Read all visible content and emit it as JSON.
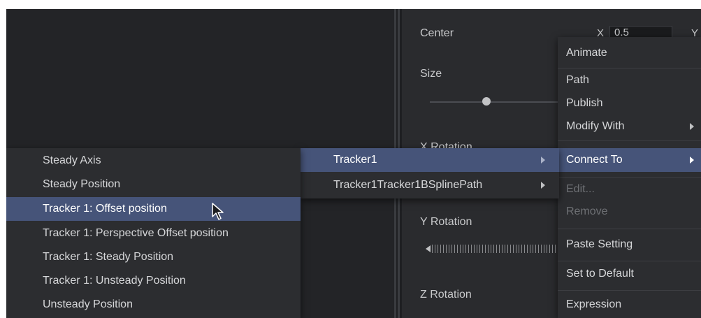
{
  "inspector": {
    "center_label": "Center",
    "center_x_label": "X",
    "center_x_value": "0.5",
    "center_y_label": "Y",
    "size_label": "Size",
    "x_rotation_label": "X Rotation",
    "y_rotation_label": "Y Rotation",
    "z_rotation_label": "Z Rotation"
  },
  "context_menu": {
    "items": [
      {
        "label": "Animate"
      },
      {
        "label": "Path"
      },
      {
        "label": "Publish"
      },
      {
        "label": "Modify With"
      },
      {
        "label": "Connect To"
      },
      {
        "label": "Edit..."
      },
      {
        "label": "Remove"
      },
      {
        "label": "Paste Setting"
      },
      {
        "label": "Set to Default"
      },
      {
        "label": "Expression"
      }
    ]
  },
  "trackers_menu": {
    "items": [
      {
        "label": "Tracker1"
      },
      {
        "label": "Tracker1Tracker1BSplinePath"
      }
    ]
  },
  "outputs_menu": {
    "items": [
      {
        "label": "Steady Axis"
      },
      {
        "label": "Steady Position"
      },
      {
        "label": "Tracker 1: Offset position"
      },
      {
        "label": "Tracker 1: Perspective Offset position"
      },
      {
        "label": "Tracker 1: Steady Position"
      },
      {
        "label": "Tracker 1: Unsteady Position"
      },
      {
        "label": "Unsteady Position"
      }
    ]
  },
  "colors": {
    "highlight": "#465479",
    "menu_bg": "#2c2d30",
    "panel_bg": "#2a2b2e",
    "text": "#d6d7d9",
    "disabled_text": "#6e7074"
  }
}
